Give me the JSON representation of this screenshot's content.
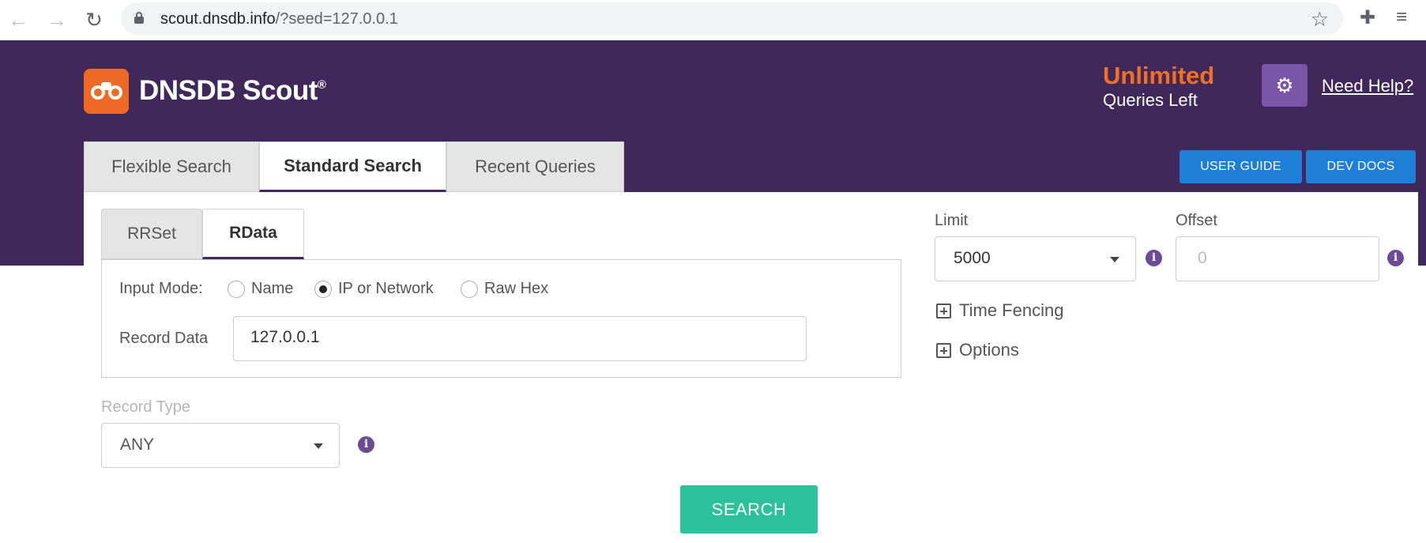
{
  "browser": {
    "url_host": "scout.dnsdb.info",
    "url_path": "/?seed=127.0.0.1"
  },
  "header": {
    "brand": "DNSDB Scout",
    "brand_mark": "®",
    "queries_count": "Unlimited",
    "queries_label": "Queries Left",
    "help_link": "Need Help?",
    "user_guide": "USER GUIDE",
    "dev_docs": "DEV DOCS"
  },
  "main_tabs": [
    {
      "label": "Flexible Search",
      "active": false
    },
    {
      "label": "Standard Search",
      "active": true
    },
    {
      "label": "Recent Queries",
      "active": false
    }
  ],
  "sub_tabs": [
    {
      "label": "RRSet",
      "active": false
    },
    {
      "label": "RData",
      "active": true
    }
  ],
  "input_mode": {
    "label": "Input Mode:",
    "options": [
      "Name",
      "IP or Network",
      "Raw Hex"
    ],
    "selected": "IP or Network"
  },
  "record_data": {
    "label": "Record Data",
    "value": "127.0.0.1"
  },
  "record_type": {
    "label": "Record Type",
    "value": "ANY"
  },
  "limit": {
    "label": "Limit",
    "value": "5000"
  },
  "offset": {
    "label": "Offset",
    "placeholder": "0"
  },
  "expanders": {
    "time_fencing": "Time Fencing",
    "options": "Options"
  },
  "search_button": "SEARCH",
  "colors": {
    "header_bg": "#41285b",
    "brand_orange": "#ee6a24",
    "button_blue": "#1f7ed6",
    "search_green": "#2bc19a",
    "info_purple": "#6b4a96"
  }
}
